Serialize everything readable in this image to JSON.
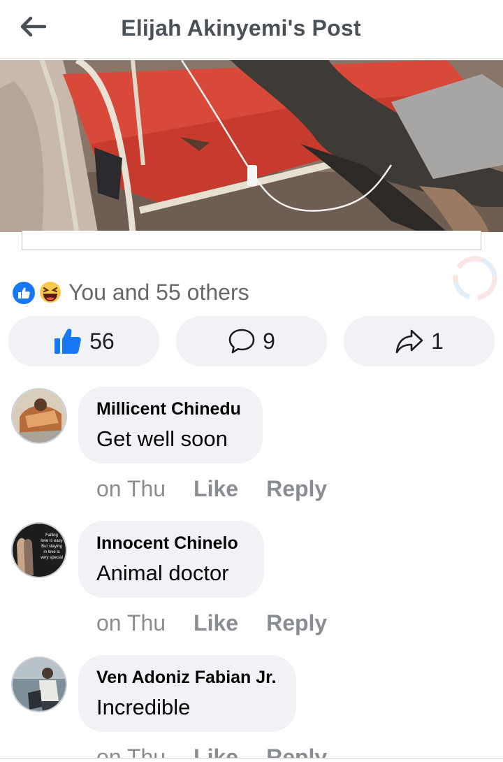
{
  "header": {
    "title": "Elijah Akinyemi's Post",
    "back_icon": "arrow-left-icon"
  },
  "post": {
    "photo_description_icon": "post-photo",
    "reactions_text": "You and 55 others",
    "reaction_types": [
      "like",
      "haha"
    ],
    "like_count": "56",
    "comment_count": "9",
    "share_count": "1"
  },
  "colors": {
    "accent": "#1877f2",
    "button_bg": "#f0f2f5",
    "muted_text": "#65676b"
  },
  "comments": [
    {
      "author": "Millicent Chinedu",
      "text": "Get well soon",
      "time": "on Thu",
      "like": "Like",
      "reply": "Reply"
    },
    {
      "author": "Innocent Chinelo",
      "text": "Animal doctor",
      "time": "on Thu",
      "like": "Like",
      "reply": "Reply",
      "avatar_caption": [
        "Falling",
        "love is easy",
        "But staying",
        "in love is",
        "very special"
      ]
    },
    {
      "author": "Ven Adoniz Fabian Jr.",
      "text": "Incredible",
      "time": "on Thu",
      "like": "Like",
      "reply": "Reply"
    }
  ]
}
